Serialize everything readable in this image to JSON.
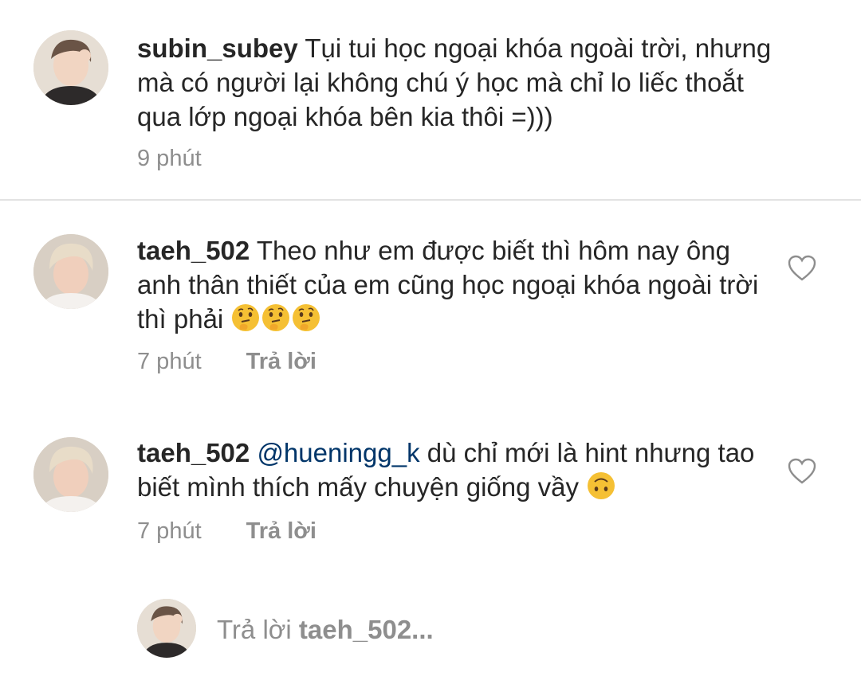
{
  "comments": [
    {
      "username": "subin_subey",
      "mention": "",
      "text": "Tụi tui học ngoại khóa ngoài trời, nhưng mà có người lại không chú ý học mà chỉ lo liếc thoắt qua lớp ngoại khóa bên kia thôi =)))",
      "time": "9 phút",
      "reply_label": "",
      "emoji": []
    },
    {
      "username": "taeh_502",
      "mention": "",
      "text": "Theo như em được biết thì hôm nay ông anh thân thiết của em cũng học ngoại khóa ngoài trời thì phải",
      "time": "7 phút",
      "reply_label": "Trả lời",
      "emoji": [
        "thinking-face-icon",
        "thinking-face-icon",
        "thinking-face-icon"
      ]
    },
    {
      "username": "taeh_502",
      "mention": "@hueningg_k",
      "text": "dù chỉ mới là hint nhưng tao biết mình thích mấy chuyện giống vầy",
      "time": "7 phút",
      "reply_label": "Trả lời",
      "emoji": [
        "upside-down-face-icon"
      ]
    }
  ],
  "reply_bar": {
    "prefix": "Trả lời",
    "target": "taeh_502..."
  },
  "colors": {
    "text": "#262626",
    "meta": "#8e8e8e",
    "mention": "#003569",
    "divider": "#e2e2e2"
  }
}
